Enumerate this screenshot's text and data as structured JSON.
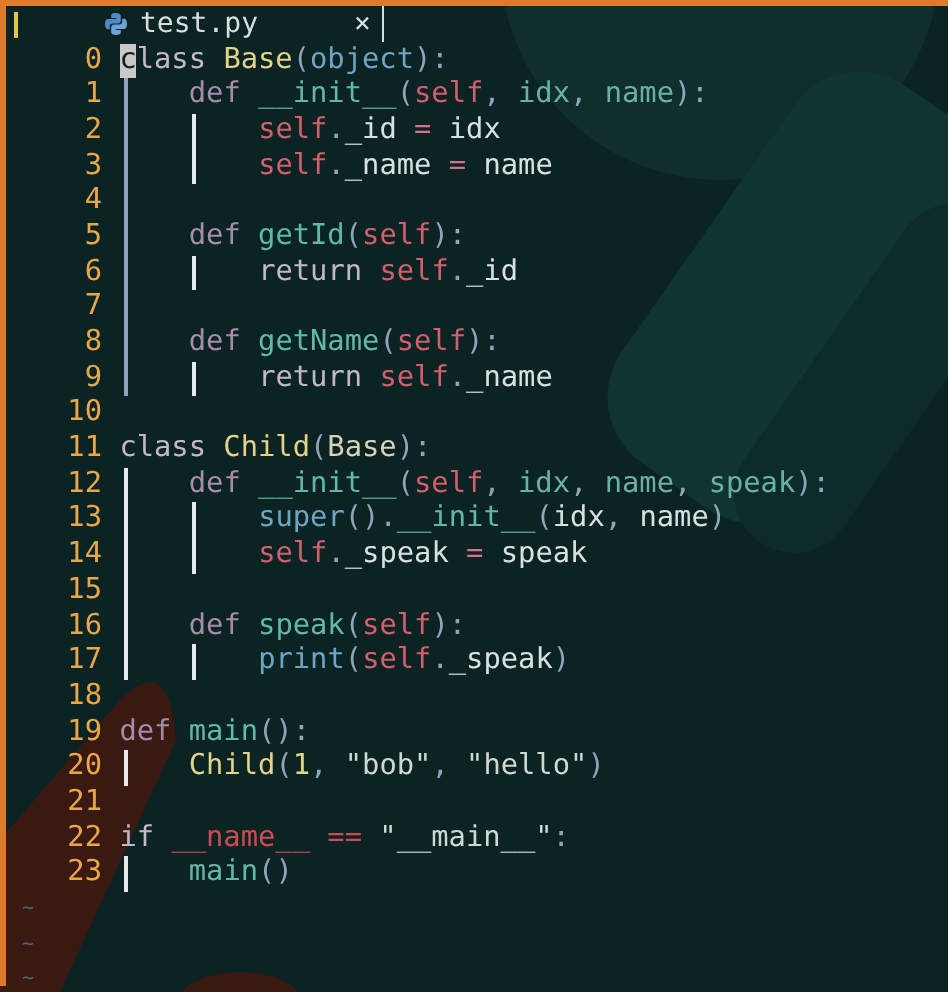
{
  "tab": {
    "title": "test.py",
    "close": "×",
    "selected": true
  },
  "lines": [
    {
      "number": "0",
      "tokens": [
        {
          "text": "c",
          "kind": "cursor"
        },
        {
          "text": "lass ",
          "kind": "kw"
        },
        {
          "text": "Base",
          "kind": "cls"
        },
        {
          "text": "(",
          "kind": "punc"
        },
        {
          "text": "object",
          "kind": "builtin"
        },
        {
          "text": "):",
          "kind": "punc"
        }
      ]
    },
    {
      "number": "1",
      "guides": [
        {
          "active": true
        }
      ],
      "tokens": [
        {
          "text": "def ",
          "kind": "def"
        },
        {
          "text": "__init__",
          "kind": "fn"
        },
        {
          "text": "(",
          "kind": "punc"
        },
        {
          "text": "self",
          "kind": "self"
        },
        {
          "text": ", ",
          "kind": "punc"
        },
        {
          "text": "idx",
          "kind": "param"
        },
        {
          "text": ", ",
          "kind": "punc"
        },
        {
          "text": "name",
          "kind": "param"
        },
        {
          "text": "):",
          "kind": "punc"
        }
      ]
    },
    {
      "number": "2",
      "guides": [
        {
          "active": true
        },
        {
          "active": false
        }
      ],
      "tokens": [
        {
          "text": "self",
          "kind": "self"
        },
        {
          "text": ".",
          "kind": "punc"
        },
        {
          "text": "_id",
          "kind": "ident"
        },
        {
          "text": " = ",
          "kind": "op"
        },
        {
          "text": "idx",
          "kind": "ident"
        }
      ]
    },
    {
      "number": "3",
      "guides": [
        {
          "active": true
        },
        {
          "active": false
        }
      ],
      "tokens": [
        {
          "text": "self",
          "kind": "self"
        },
        {
          "text": ".",
          "kind": "punc"
        },
        {
          "text": "_name",
          "kind": "ident"
        },
        {
          "text": " = ",
          "kind": "op"
        },
        {
          "text": "name",
          "kind": "ident"
        }
      ]
    },
    {
      "number": "4",
      "guides": [
        {
          "active": true
        }
      ]
    },
    {
      "number": "5",
      "guides": [
        {
          "active": true
        }
      ],
      "tokens": [
        {
          "text": "def ",
          "kind": "def"
        },
        {
          "text": "getId",
          "kind": "fn"
        },
        {
          "text": "(",
          "kind": "punc"
        },
        {
          "text": "self",
          "kind": "self"
        },
        {
          "text": "):",
          "kind": "punc"
        }
      ]
    },
    {
      "number": "6",
      "guides": [
        {
          "active": true
        },
        {
          "active": false
        }
      ],
      "tokens": [
        {
          "text": "return ",
          "kind": "kw"
        },
        {
          "text": "self",
          "kind": "self"
        },
        {
          "text": ".",
          "kind": "punc"
        },
        {
          "text": "_id",
          "kind": "ident"
        }
      ]
    },
    {
      "number": "7",
      "guides": [
        {
          "active": true
        }
      ]
    },
    {
      "number": "8",
      "guides": [
        {
          "active": true
        }
      ],
      "tokens": [
        {
          "text": "def ",
          "kind": "def"
        },
        {
          "text": "getName",
          "kind": "fn"
        },
        {
          "text": "(",
          "kind": "punc"
        },
        {
          "text": "self",
          "kind": "self"
        },
        {
          "text": "):",
          "kind": "punc"
        }
      ]
    },
    {
      "number": "9",
      "guides": [
        {
          "active": true
        },
        {
          "active": false
        }
      ],
      "tokens": [
        {
          "text": "return ",
          "kind": "kw"
        },
        {
          "text": "self",
          "kind": "self"
        },
        {
          "text": ".",
          "kind": "punc"
        },
        {
          "text": "_name",
          "kind": "ident"
        }
      ]
    },
    {
      "number": "10"
    },
    {
      "number": "11",
      "tokens": [
        {
          "text": "class ",
          "kind": "kw"
        },
        {
          "text": "Child",
          "kind": "cls"
        },
        {
          "text": "(",
          "kind": "punc"
        },
        {
          "text": "Base",
          "kind": "base"
        },
        {
          "text": "):",
          "kind": "punc"
        }
      ]
    },
    {
      "number": "12",
      "guides": [
        {
          "active": false
        }
      ],
      "tokens": [
        {
          "text": "def ",
          "kind": "def"
        },
        {
          "text": "__init__",
          "kind": "fn"
        },
        {
          "text": "(",
          "kind": "punc"
        },
        {
          "text": "self",
          "kind": "self"
        },
        {
          "text": ", ",
          "kind": "punc"
        },
        {
          "text": "idx",
          "kind": "param"
        },
        {
          "text": ", ",
          "kind": "punc"
        },
        {
          "text": "name",
          "kind": "param"
        },
        {
          "text": ", ",
          "kind": "punc"
        },
        {
          "text": "speak",
          "kind": "param"
        },
        {
          "text": "):",
          "kind": "punc"
        }
      ]
    },
    {
      "number": "13",
      "guides": [
        {
          "active": false
        },
        {
          "active": false
        }
      ],
      "tokens": [
        {
          "text": "super",
          "kind": "builtin"
        },
        {
          "text": "().",
          "kind": "punc"
        },
        {
          "text": "__init__",
          "kind": "fn"
        },
        {
          "text": "(",
          "kind": "punc"
        },
        {
          "text": "idx",
          "kind": "ident"
        },
        {
          "text": ", ",
          "kind": "punc"
        },
        {
          "text": "name",
          "kind": "ident"
        },
        {
          "text": ")",
          "kind": "punc"
        }
      ]
    },
    {
      "number": "14",
      "guides": [
        {
          "active": false
        },
        {
          "active": false
        }
      ],
      "tokens": [
        {
          "text": "self",
          "kind": "self"
        },
        {
          "text": ".",
          "kind": "punc"
        },
        {
          "text": "_speak",
          "kind": "ident"
        },
        {
          "text": " = ",
          "kind": "op"
        },
        {
          "text": "speak",
          "kind": "ident"
        }
      ]
    },
    {
      "number": "15",
      "guides": [
        {
          "active": false
        }
      ]
    },
    {
      "number": "16",
      "guides": [
        {
          "active": false
        }
      ],
      "tokens": [
        {
          "text": "def ",
          "kind": "def"
        },
        {
          "text": "speak",
          "kind": "fn"
        },
        {
          "text": "(",
          "kind": "punc"
        },
        {
          "text": "self",
          "kind": "self"
        },
        {
          "text": "):",
          "kind": "punc"
        }
      ]
    },
    {
      "number": "17",
      "guides": [
        {
          "active": false
        },
        {
          "active": false
        }
      ],
      "tokens": [
        {
          "text": "print",
          "kind": "builtin"
        },
        {
          "text": "(",
          "kind": "punc"
        },
        {
          "text": "self",
          "kind": "self"
        },
        {
          "text": ".",
          "kind": "punc"
        },
        {
          "text": "_speak",
          "kind": "ident"
        },
        {
          "text": ")",
          "kind": "punc"
        }
      ]
    },
    {
      "number": "18"
    },
    {
      "number": "19",
      "tokens": [
        {
          "text": "def ",
          "kind": "def"
        },
        {
          "text": "main",
          "kind": "fn"
        },
        {
          "text": "():",
          "kind": "punc"
        }
      ]
    },
    {
      "number": "20",
      "guides": [
        {
          "active": false
        }
      ],
      "tokens": [
        {
          "text": "Child",
          "kind": "cls"
        },
        {
          "text": "(",
          "kind": "punc"
        },
        {
          "text": "1",
          "kind": "num"
        },
        {
          "text": ", ",
          "kind": "punc"
        },
        {
          "text": "\"bob\"",
          "kind": "str"
        },
        {
          "text": ", ",
          "kind": "punc"
        },
        {
          "text": "\"hello\"",
          "kind": "str"
        },
        {
          "text": ")",
          "kind": "punc"
        }
      ]
    },
    {
      "number": "21"
    },
    {
      "number": "22",
      "tokens": [
        {
          "text": "if ",
          "kind": "kw"
        },
        {
          "text": "__name__",
          "kind": "dunder"
        },
        {
          "text": " == ",
          "kind": "eq"
        },
        {
          "text": "\"__main__\"",
          "kind": "str"
        },
        {
          "text": ":",
          "kind": "punc"
        }
      ]
    },
    {
      "number": "23",
      "guides": [
        {
          "active": false
        }
      ],
      "tokens": [
        {
          "text": "main",
          "kind": "fn"
        },
        {
          "text": "()",
          "kind": "punc"
        }
      ]
    }
  ],
  "tildes": [
    "~",
    "~",
    "~"
  ]
}
